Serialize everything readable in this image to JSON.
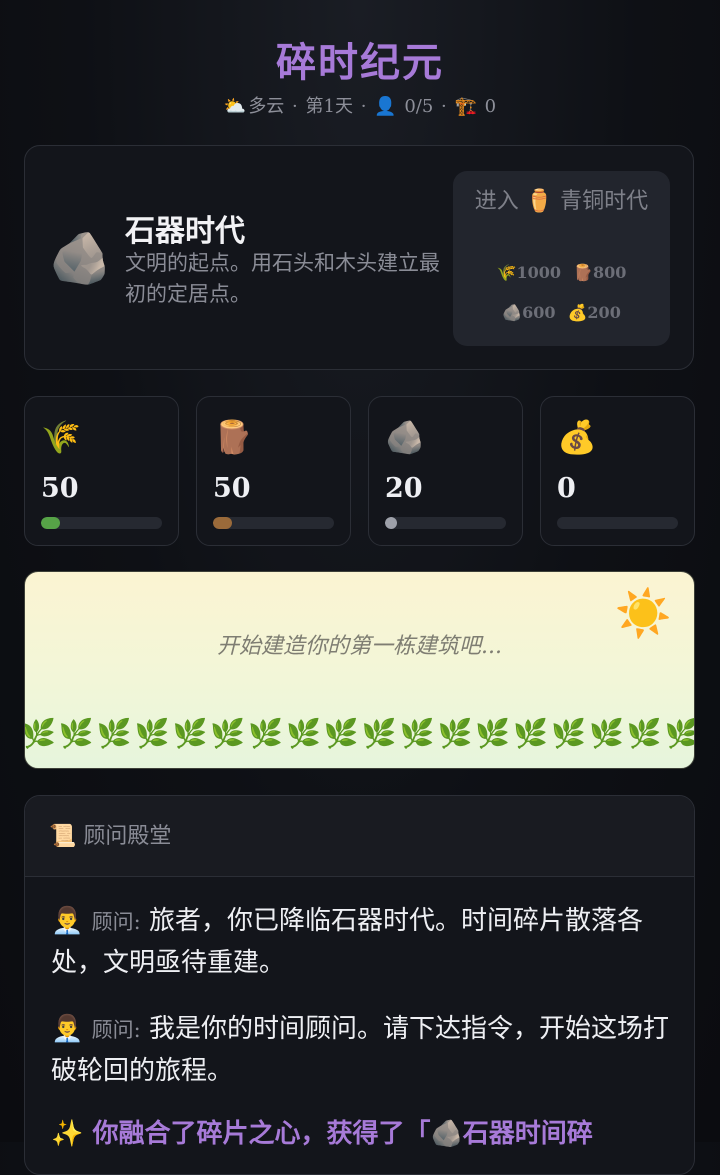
{
  "app_title": "碎时纪元",
  "status": {
    "weather_icon": "⛅",
    "weather": "多云",
    "day": "第1天",
    "population_icon": "👤",
    "population": "0/5",
    "building_icon": "🏗️",
    "buildings": "0",
    "separator": "·"
  },
  "era": {
    "icon": "🪨",
    "name": "石器时代",
    "description": "文明的起点。用石头和木头建立最初的定居点。",
    "advance": {
      "label": "进入 ⚱️ 青铜时代",
      "costs": [
        {
          "icon": "🌾",
          "amount": "1000"
        },
        {
          "icon": "🪵",
          "amount": "800"
        },
        {
          "icon": "🪨",
          "amount": "600"
        },
        {
          "icon": "💰",
          "amount": "200"
        }
      ]
    }
  },
  "resources": [
    {
      "name": "food",
      "icon": "🌾",
      "value": "50",
      "fill": 0.16,
      "color": "#56a347"
    },
    {
      "name": "wood",
      "icon": "🪵",
      "value": "50",
      "fill": 0.16,
      "color": "#9a6a3a"
    },
    {
      "name": "stone",
      "icon": "🪨",
      "value": "20",
      "fill": 0.1,
      "color": "#9ea1aa"
    },
    {
      "name": "gold",
      "icon": "💰",
      "value": "0",
      "fill": 0,
      "color": "#d4a93a"
    }
  ],
  "scene": {
    "sun_icon": "☀️",
    "text": "开始建造你的第一栋建筑吧...",
    "grass_icon": "🌿"
  },
  "advisor": {
    "icon": "📜",
    "title": "顾问殿堂",
    "messages": [
      {
        "icon": "👨‍💼",
        "speaker": "顾问:",
        "text": "旅者，你已降临石器时代。时间碎片散落各处，文明亟待重建。"
      },
      {
        "icon": "👨‍💼",
        "speaker": "顾问:",
        "text": "我是你的时间顾问。请下达指令，开始这场打破轮回的旅程。"
      }
    ],
    "special": {
      "icon": "✨",
      "text": "你融合了碎片之心，获得了「🪨石器时间碎"
    }
  }
}
